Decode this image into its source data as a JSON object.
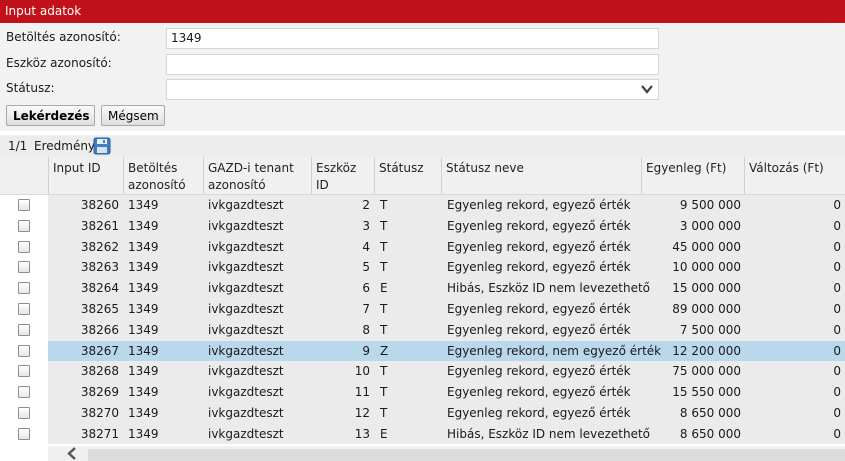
{
  "panel": {
    "title": "Input adatok"
  },
  "form": {
    "betoltes_label": "Betöltés azonosító:",
    "betoltes_value": "1349",
    "eszkoz_label": "Eszköz azonosító:",
    "eszkoz_value": "",
    "statusz_label": "Státusz:",
    "statusz_value": "",
    "query_button": "Lekérdezés",
    "cancel_button": "Mégsem"
  },
  "results": {
    "count": "1/1",
    "label": "Eredmény"
  },
  "columns": {
    "input_id": "Input ID",
    "betoltes": "Betöltés\nazonosító",
    "tenant": "GAZD-i tenant\nazonosító",
    "eszkoz": "Eszköz\nID",
    "statusz": "Státusz",
    "statusz_neve": "Státusz neve",
    "egyenleg": "Egyenleg (Ft)",
    "valtozas": "Változás (Ft)"
  },
  "rows": [
    {
      "input_id": "38260",
      "betoltes": "1349",
      "tenant": "ivkgazdteszt",
      "eszkoz": "2",
      "statusz": "T",
      "statusz_neve": "Egyenleg rekord, egyező érték",
      "egyenleg": "9 500 000",
      "valtozas": "0"
    },
    {
      "input_id": "38261",
      "betoltes": "1349",
      "tenant": "ivkgazdteszt",
      "eszkoz": "3",
      "statusz": "T",
      "statusz_neve": "Egyenleg rekord, egyező érték",
      "egyenleg": "3 000 000",
      "valtozas": "0"
    },
    {
      "input_id": "38262",
      "betoltes": "1349",
      "tenant": "ivkgazdteszt",
      "eszkoz": "4",
      "statusz": "T",
      "statusz_neve": "Egyenleg rekord, egyező érték",
      "egyenleg": "45 000 000",
      "valtozas": "0"
    },
    {
      "input_id": "38263",
      "betoltes": "1349",
      "tenant": "ivkgazdteszt",
      "eszkoz": "5",
      "statusz": "T",
      "statusz_neve": "Egyenleg rekord, egyező érték",
      "egyenleg": "10 000 000",
      "valtozas": "0"
    },
    {
      "input_id": "38264",
      "betoltes": "1349",
      "tenant": "ivkgazdteszt",
      "eszkoz": "6",
      "statusz": "E",
      "statusz_neve": "Hibás, Eszköz ID nem levezethető",
      "egyenleg": "15 000 000",
      "valtozas": "0"
    },
    {
      "input_id": "38265",
      "betoltes": "1349",
      "tenant": "ivkgazdteszt",
      "eszkoz": "7",
      "statusz": "T",
      "statusz_neve": "Egyenleg rekord, egyező érték",
      "egyenleg": "89 000 000",
      "valtozas": "0"
    },
    {
      "input_id": "38266",
      "betoltes": "1349",
      "tenant": "ivkgazdteszt",
      "eszkoz": "8",
      "statusz": "T",
      "statusz_neve": "Egyenleg rekord, egyező érték",
      "egyenleg": "7 500 000",
      "valtozas": "0"
    },
    {
      "input_id": "38267",
      "betoltes": "1349",
      "tenant": "ivkgazdteszt",
      "eszkoz": "9",
      "statusz": "Z",
      "statusz_neve": "Egyenleg rekord, nem egyező érték",
      "egyenleg": "12 200 000",
      "valtozas": "0",
      "selected": true
    },
    {
      "input_id": "38268",
      "betoltes": "1349",
      "tenant": "ivkgazdteszt",
      "eszkoz": "10",
      "statusz": "T",
      "statusz_neve": "Egyenleg rekord, egyező érték",
      "egyenleg": "75 000 000",
      "valtozas": "0"
    },
    {
      "input_id": "38269",
      "betoltes": "1349",
      "tenant": "ivkgazdteszt",
      "eszkoz": "11",
      "statusz": "T",
      "statusz_neve": "Egyenleg rekord, egyező érték",
      "egyenleg": "15 550 000",
      "valtozas": "0"
    },
    {
      "input_id": "38270",
      "betoltes": "1349",
      "tenant": "ivkgazdteszt",
      "eszkoz": "12",
      "statusz": "T",
      "statusz_neve": "Egyenleg rekord, egyező érték",
      "egyenleg": "8 650 000",
      "valtozas": "0"
    },
    {
      "input_id": "38271",
      "betoltes": "1349",
      "tenant": "ivkgazdteszt",
      "eszkoz": "13",
      "statusz": "E",
      "statusz_neve": "Hibás, Eszköz ID nem levezethető",
      "egyenleg": "8 650 000",
      "valtozas": "0"
    }
  ],
  "icons": {
    "save": "save-icon",
    "dropdown": "chevron-down-icon",
    "scroll_left": "chevron-left-icon"
  },
  "colors": {
    "title_bar": "#c1121b",
    "selected_row": "#b9d8ec"
  }
}
